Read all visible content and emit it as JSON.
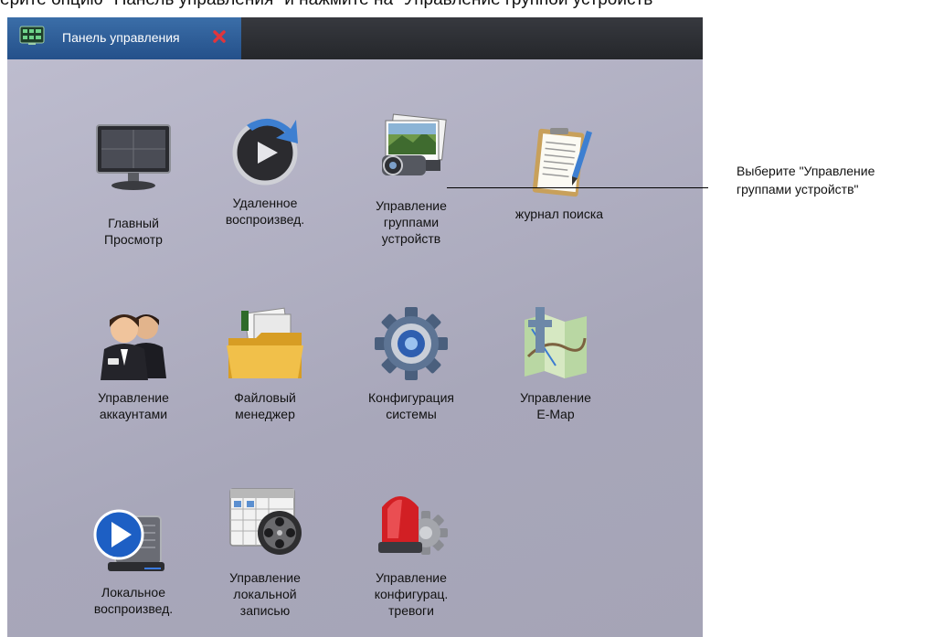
{
  "caption": "ерите опцию \"Панель управления\" и нажмите на \"Управление группой устройств\"",
  "window": {
    "tab_title": "Панель управления"
  },
  "items": [
    {
      "label": "Главный\nПросмотр",
      "icon": "monitor-icon"
    },
    {
      "label": "Удаленное\nвоспроизвед.",
      "icon": "remote-playback-icon"
    },
    {
      "label": "Управление\nгруппами\nустройств",
      "icon": "device-group-icon"
    },
    {
      "label": "журнал поиска",
      "icon": "log-search-icon"
    },
    {
      "label": "Управление\nаккаунтами",
      "icon": "users-icon"
    },
    {
      "label": "Файловый\nменеджер",
      "icon": "folder-icon"
    },
    {
      "label": "Конфигурация\nсистемы",
      "icon": "gear-icon"
    },
    {
      "label": "Управление\nE-Map",
      "icon": "map-icon"
    },
    {
      "label": "Локальное\nвоспроизвед.",
      "icon": "local-playback-icon"
    },
    {
      "label": "Управление\nлокальной\nзаписью",
      "icon": "recording-icon"
    },
    {
      "label": "Управление\nконфигурац.\nтревоги",
      "icon": "alarm-icon"
    }
  ],
  "callout": {
    "text": "Выберите \"Управление\nгруппами устройств\""
  },
  "colors": {
    "background": "#aeadbe",
    "tab_active": "#2f609a",
    "close_red": "#e0353c"
  }
}
